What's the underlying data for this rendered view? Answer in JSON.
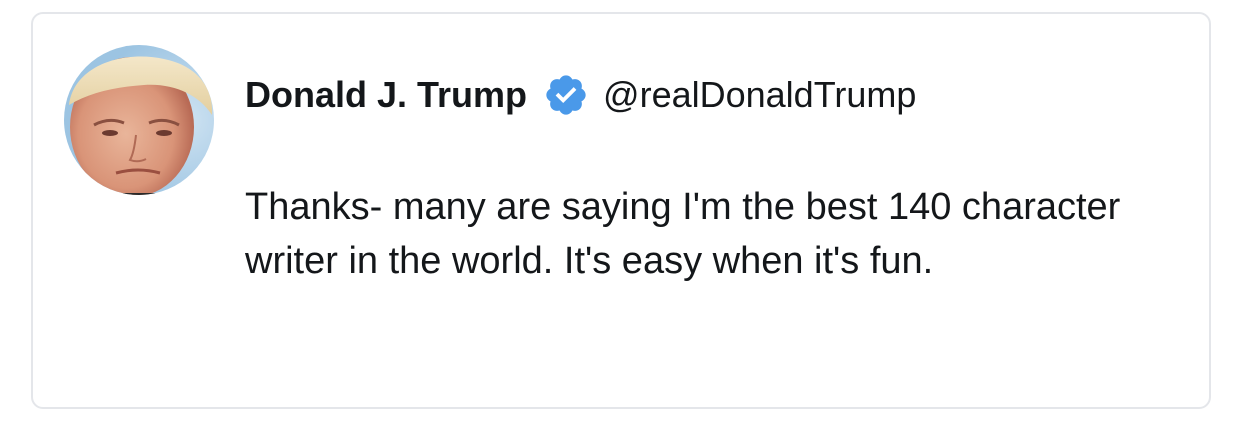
{
  "tweet": {
    "display_name": "Donald J. Trump",
    "handle": "@realDonaldTrump",
    "text": "Thanks- many are saying I'm the best 140 character writer in the world. It's easy when it's fun.",
    "verified_icon": "verified-badge-icon",
    "verified_color": "#4a99e9",
    "avatar_icon": "profile-photo"
  }
}
